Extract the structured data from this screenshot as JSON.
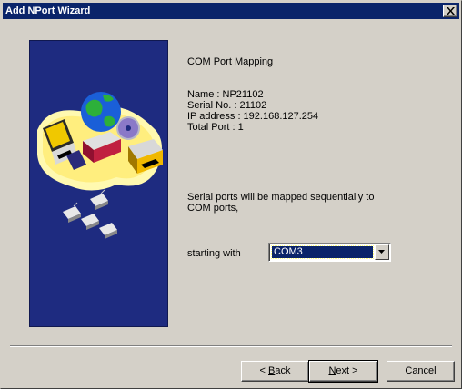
{
  "window": {
    "title": "Add NPort Wizard",
    "close_glyph": "close-icon"
  },
  "page": {
    "heading": "COM Port Mapping",
    "name_line": "Name : NP21102",
    "serial_line": "Serial No. : 21102",
    "ip_line": "IP address : 192.168.127.254",
    "total_port_line": "Total Port : 1",
    "mapping_text_1": "Serial ports will be mapped sequentially to",
    "mapping_text_2": "COM ports,",
    "starting_label": "starting with",
    "com_select": {
      "value": "COM3"
    }
  },
  "buttons": {
    "back": {
      "prefix": "< ",
      "mnemonic": "B",
      "suffix": "ack"
    },
    "next": {
      "mnemonic": "N",
      "suffix": "ext >"
    },
    "cancel": "Cancel"
  },
  "colors": {
    "titlebar": "#0a246a",
    "dialog_bg": "#d4d0c8",
    "wizard_image_bg": "#1e2b80",
    "selection": "#0a246a"
  }
}
